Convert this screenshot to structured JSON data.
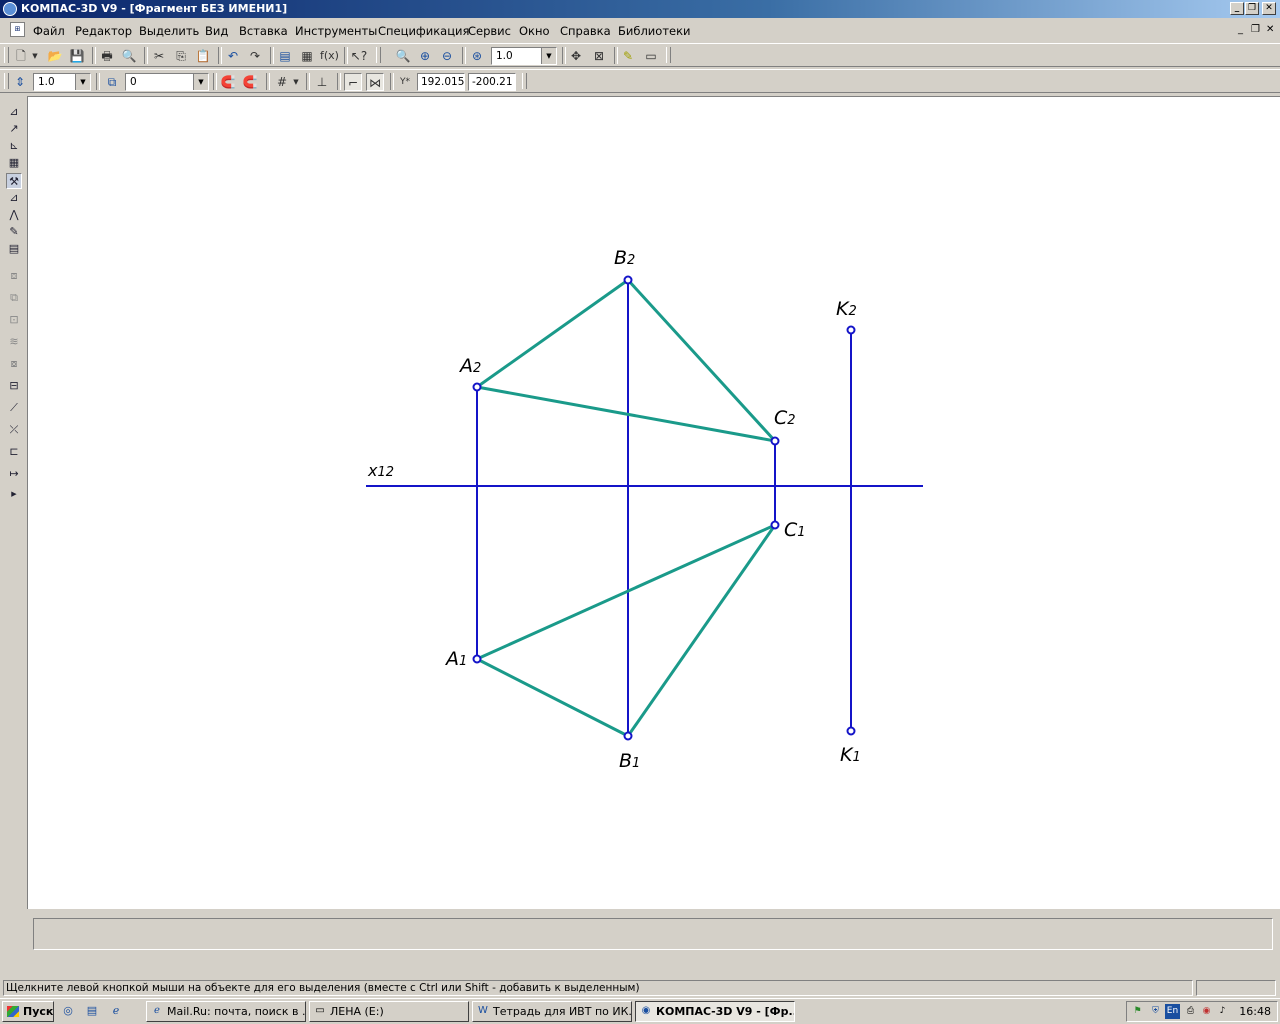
{
  "window": {
    "title": "КОМПАС-3D V9 - [Фрагмент БЕЗ ИМЕНИ1]",
    "controls": [
      "_",
      "❐",
      "✕"
    ]
  },
  "menu": {
    "items": [
      "Файл",
      "Редактор",
      "Выделить",
      "Вид",
      "Вставка",
      "Инструменты",
      "Спецификация",
      "Сервис",
      "Окно",
      "Справка",
      "Библиотеки"
    ],
    "mdi_controls": [
      "_",
      "❐",
      "✕"
    ]
  },
  "toolbar1": {
    "zoom_value": "1.0"
  },
  "toolbar2": {
    "step_value": "1.0",
    "layer_value": "0",
    "coord_x": "192.015",
    "coord_y": "-200.21"
  },
  "drawing": {
    "colors": {
      "axis": "#1414c8",
      "triangle": "#1a9a8a",
      "point": "#1414c8"
    },
    "axis_label": "x12",
    "labels": {
      "A2": "A2",
      "B2": "B2",
      "C2": "C2",
      "K2": "K2",
      "A1": "A1",
      "B1": "B1",
      "C1": "C1",
      "K1": "K1"
    }
  },
  "status": {
    "message": "Щелкните левой кнопкой мыши на объекте для его выделения (вместе с Ctrl или Shift - добавить к выделенным)"
  },
  "taskbar": {
    "start_label": "Пуск",
    "tasks": [
      {
        "label": "Mail.Ru: почта, поиск в ...",
        "icon": "ie-icon"
      },
      {
        "label": "ЛЕНА (E:)",
        "icon": "drive-icon"
      },
      {
        "label": "Тетрадь для ИВТ по ИК...",
        "icon": "word-icon"
      },
      {
        "label": "КОМПАС-3D V9 - [Фр...",
        "icon": "kompas-icon"
      }
    ],
    "language": "En",
    "clock": "16:48"
  }
}
